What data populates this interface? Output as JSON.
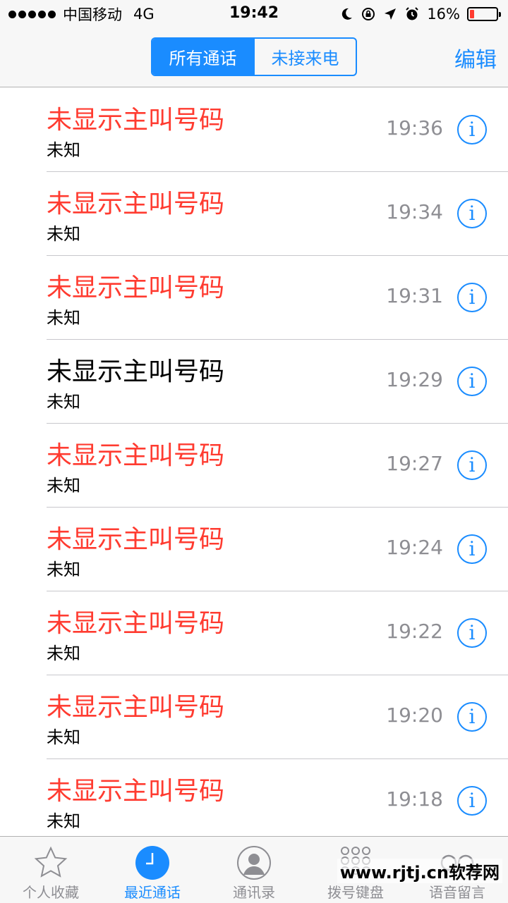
{
  "status_bar": {
    "carrier": "中国移动",
    "network": "4G",
    "time": "19:42",
    "battery_percent": "16%",
    "battery_level": 0.16
  },
  "nav": {
    "segments": [
      "所有通话",
      "未接来电"
    ],
    "active_segment": 0,
    "edit_label": "编辑"
  },
  "calls": [
    {
      "name": "未显示主叫号码",
      "label": "未知",
      "time": "19:36",
      "missed": true
    },
    {
      "name": "未显示主叫号码",
      "label": "未知",
      "time": "19:34",
      "missed": true
    },
    {
      "name": "未显示主叫号码",
      "label": "未知",
      "time": "19:31",
      "missed": true
    },
    {
      "name": "未显示主叫号码",
      "label": "未知",
      "time": "19:29",
      "missed": false
    },
    {
      "name": "未显示主叫号码",
      "label": "未知",
      "time": "19:27",
      "missed": true
    },
    {
      "name": "未显示主叫号码",
      "label": "未知",
      "time": "19:24",
      "missed": true
    },
    {
      "name": "未显示主叫号码",
      "label": "未知",
      "time": "19:22",
      "missed": true
    },
    {
      "name": "未显示主叫号码",
      "label": "未知",
      "time": "19:20",
      "missed": true
    },
    {
      "name": "未显示主叫号码",
      "label": "未知",
      "time": "19:18",
      "missed": true
    }
  ],
  "info_glyph": "i",
  "tabs": [
    {
      "label": "个人收藏",
      "icon": "star-icon"
    },
    {
      "label": "最近通话",
      "icon": "clock-icon"
    },
    {
      "label": "通讯录",
      "icon": "contacts-icon"
    },
    {
      "label": "拨号键盘",
      "icon": "keypad-icon"
    },
    {
      "label": "语音留言",
      "icon": "voicemail-icon"
    }
  ],
  "active_tab": 1,
  "watermark": "www.rjtj.cn软荐网",
  "colors": {
    "accent": "#1a8cff",
    "missed": "#ff3b30",
    "secondary": "#8e8e93"
  }
}
